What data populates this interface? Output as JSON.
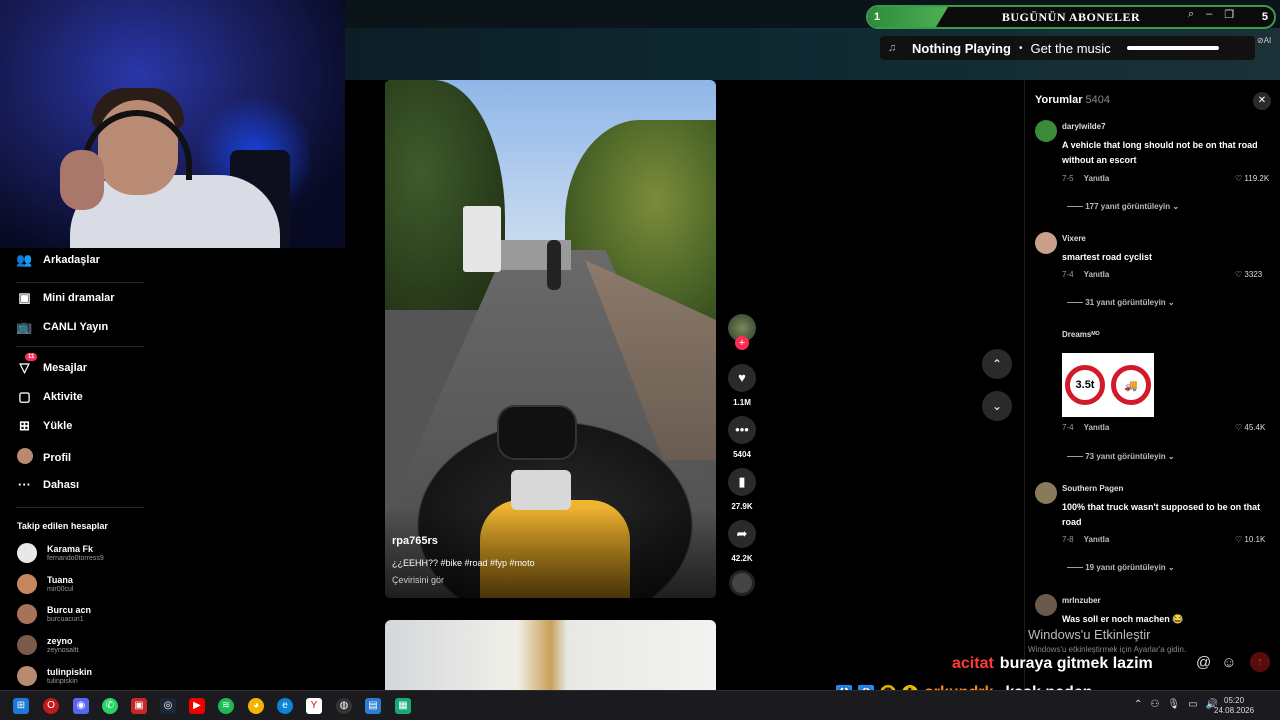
{
  "overlay": {
    "subs": {
      "number": "1",
      "title": "BUGÜNÜN ABONELER",
      "right_number": "5"
    },
    "music": {
      "status": "Nothing Playing",
      "separator": "•",
      "cta": "Get the music",
      "ai_label": "⊘AI"
    },
    "chat": [
      {
        "user": "acitat",
        "message": "buraya gitmek lazim"
      },
      {
        "user": "orkundrk",
        "message": "kask neden",
        "badge_num": "1"
      }
    ]
  },
  "sidebar": {
    "items": [
      {
        "label": "Arkadaşlar",
        "icon": "friends-icon",
        "glyph": "👥"
      },
      {
        "label": "Mini dramalar",
        "icon": "mini-drama-icon",
        "glyph": "▣"
      },
      {
        "label": "CANLI Yayın",
        "icon": "live-icon",
        "glyph": "📺"
      },
      {
        "label": "Mesajlar",
        "icon": "messages-icon",
        "glyph": "▽",
        "badge": "11"
      },
      {
        "label": "Aktivite",
        "icon": "activity-icon",
        "glyph": "▢"
      },
      {
        "label": "Yükle",
        "icon": "upload-icon",
        "glyph": "⊞"
      },
      {
        "label": "Profil",
        "icon": "profile-avatar",
        "glyph": "●"
      },
      {
        "label": "Dahası",
        "icon": "more-icon",
        "glyph": "···"
      }
    ],
    "followed_title": "Takip edilen hesaplar",
    "followed": [
      {
        "name": "Karama Fk",
        "handle": "fernando0torress9",
        "color": "#e8e8e8"
      },
      {
        "name": "Tuana",
        "handle": "mir00cul",
        "color": "#c4875d"
      },
      {
        "name": "Burcu acn",
        "handle": "burcuacun1",
        "color": "#a7725a"
      },
      {
        "name": "zeyno",
        "handle": "zeynosaltt",
        "color": "#7a5a4a"
      },
      {
        "name": "tulinpiskin",
        "handle": "tulinpiskin",
        "color": "#b88a70"
      }
    ]
  },
  "video": {
    "username": "rpa765rs",
    "caption": "¿¿EEHH?? #bike #road #fyp #moto",
    "translate": "Çevirisini gör"
  },
  "actions": {
    "likes": "1.1M",
    "comments": "5404",
    "saves": "27.9K",
    "shares": "42.2K"
  },
  "comments": {
    "title": "Yorumlar",
    "count": "5404",
    "reply_label": "Yanıtla",
    "items": [
      {
        "user": "darylwilde7",
        "text": "A vehicle that long should not be on that road without an escort",
        "date": "7-5",
        "likes": "119.2K",
        "replies": "177 yanıt görüntüleyin",
        "color": "#3a8a3a"
      },
      {
        "user": "Vixere",
        "text": "smartest road cyclist",
        "date": "7-4",
        "likes": "3323",
        "replies": "31 yanıt görüntüleyin",
        "color": "#c9a08a"
      },
      {
        "user": "Dreamsᴹᴼ",
        "text": "",
        "date": "7-4",
        "likes": "45.4K",
        "replies": "73 yanıt görüntüleyin",
        "color": "#000000",
        "sign1": "3.5t",
        "sign2": "🚚"
      },
      {
        "user": "Southern Pagen",
        "text": "100% that truck wasn't supposed to be on that road",
        "date": "7-8",
        "likes": "10.1K",
        "replies": "19 yanıt görüntüleyin",
        "color": "#8a7a5a"
      },
      {
        "user": "mrlnzuber",
        "text": "Was soll er noch machen 😂",
        "color": "#6a5a4a"
      }
    ]
  },
  "windows": {
    "watermark": "Windows'u Etkinleştir",
    "watermark_sub": "Windows'u etkinleştirmek için Ayarlar'a gidin.",
    "time": "05:20",
    "date": "24.08.2026"
  }
}
